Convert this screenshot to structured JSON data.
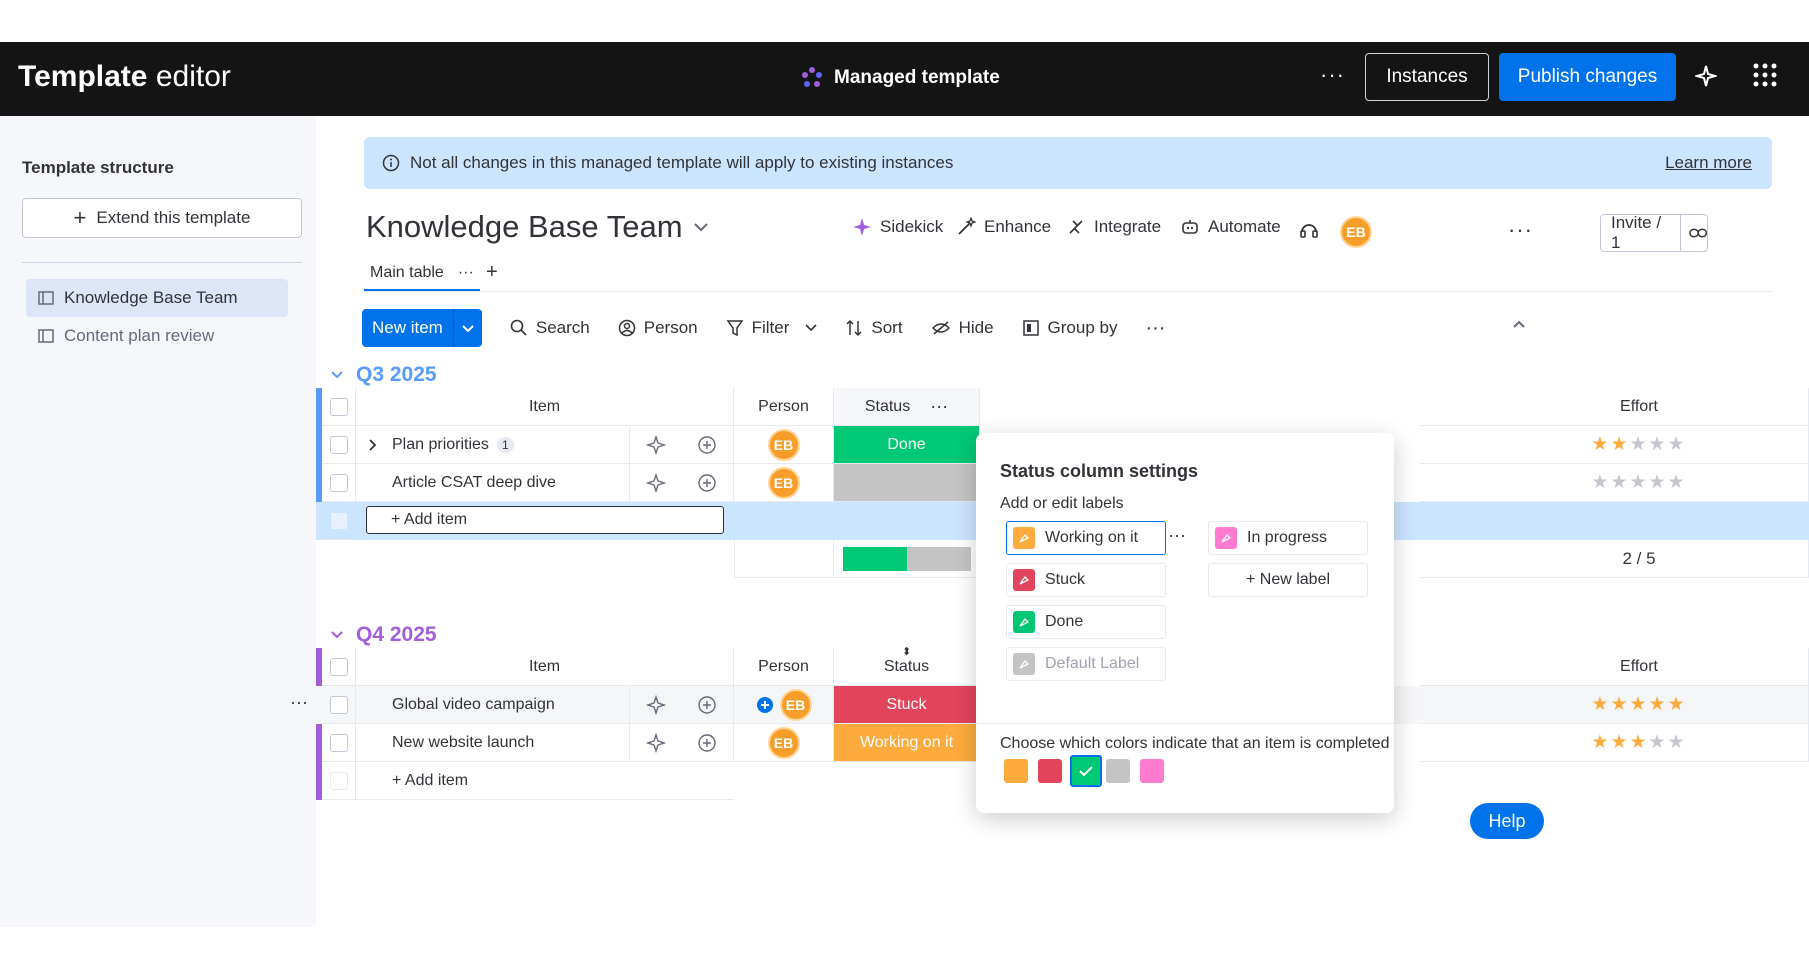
{
  "topbar": {
    "title_bold": "Template",
    "title_rest": "editor",
    "managed_label": "Managed template",
    "more_icon": "···",
    "instances_label": "Instances",
    "publish_label": "Publish changes"
  },
  "sidebar": {
    "heading": "Template structure",
    "extend_label": "Extend this template",
    "items": [
      {
        "label": "Knowledge Base Team",
        "active": true
      },
      {
        "label": "Content plan review",
        "active": false
      }
    ]
  },
  "banner": {
    "text": "Not all changes in this managed template will apply to existing instances",
    "link": "Learn more"
  },
  "board": {
    "title": "Knowledge Base Team",
    "actions": [
      "Sidekick",
      "Enhance",
      "Integrate",
      "Automate"
    ],
    "avatar": "EB",
    "invite": "Invite / 1",
    "tab": "Main table",
    "tab_more": "···",
    "tab_add": "+"
  },
  "toolbar": {
    "new_item": "New item",
    "search": "Search",
    "person": "Person",
    "filter": "Filter",
    "sort": "Sort",
    "hide": "Hide",
    "group_by": "Group by",
    "more": "···"
  },
  "columns": {
    "item": "Item",
    "person": "Person",
    "status": "Status",
    "effort": "Effort"
  },
  "groups": [
    {
      "title": "Q3 2025",
      "color": "#579bfc",
      "rows": [
        {
          "name": "Plan priorities",
          "subitems": "1",
          "avatar": "EB",
          "status": "Done",
          "status_color": "#00c875",
          "effort": 2
        },
        {
          "name": "Article CSAT deep dive",
          "subitems": "",
          "avatar": "EB",
          "status": "",
          "status_color": "#c4c4c4",
          "effort": 0
        }
      ],
      "add_item": "+ Add item",
      "summary_effort": "2 / 5"
    },
    {
      "title": "Q4 2025",
      "color": "#a25ddc",
      "rows": [
        {
          "name": "Global video campaign",
          "subitems": "",
          "avatar": "EB",
          "status": "Stuck",
          "status_color": "#e2445c",
          "effort": 5
        },
        {
          "name": "New website launch",
          "subitems": "",
          "avatar": "EB",
          "status": "Working on it",
          "status_color": "#fdab3d",
          "effort": 3
        }
      ],
      "add_item": "+ Add item"
    }
  ],
  "popover": {
    "title": "Status column settings",
    "subtitle": "Add or edit labels",
    "labels": [
      {
        "text": "Working on it",
        "color": "#fdab3d"
      },
      {
        "text": "Stuck",
        "color": "#e2445c"
      },
      {
        "text": "Done",
        "color": "#00c875"
      },
      {
        "text": "Default Label",
        "color": "#c4c4c4"
      },
      {
        "text": "In progress",
        "color": "#ff7bd0"
      }
    ],
    "new_label": "+ New label",
    "colors_title": "Choose which colors indicate that an item is completed",
    "completion_colors": [
      "#fdab3d",
      "#e2445c",
      "#00c875",
      "#c4c4c4",
      "#ff7bd0"
    ],
    "selected_completion_color": "#00c875"
  },
  "help": "Help"
}
